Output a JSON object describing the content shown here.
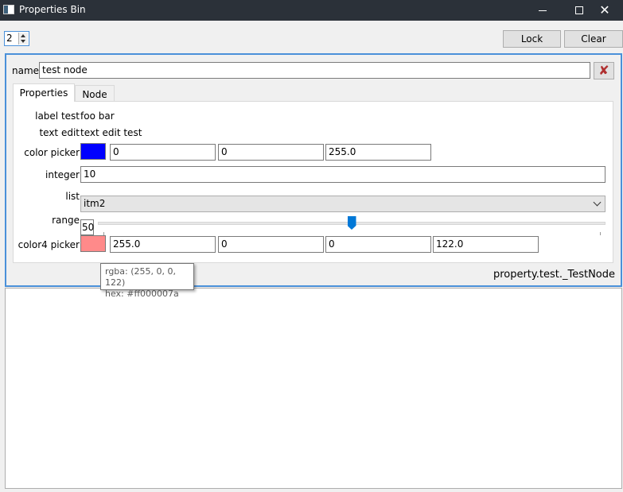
{
  "window": {
    "title": "Properties Bin",
    "controls": {
      "minimize": "minimize-icon",
      "maximize": "maximize-icon",
      "close": "close-icon"
    }
  },
  "toolbar": {
    "spin_value": "2",
    "lock_label": "Lock",
    "clear_label": "Clear"
  },
  "node": {
    "name_label": "name",
    "name_value": "test node",
    "remove_icon": "red-x-icon",
    "tabs": [
      {
        "label": "Properties",
        "active": true
      },
      {
        "label": "Node",
        "active": false
      }
    ],
    "properties": {
      "label_test": {
        "label": "label test",
        "value": "foo bar"
      },
      "text_edit": {
        "label": "text edit",
        "value": "text edit test"
      },
      "color_picker": {
        "label": "color picker",
        "swatch": "#0000ff",
        "values": [
          "0",
          "0",
          "255.0"
        ]
      },
      "integer": {
        "label": "integer",
        "value": "10"
      },
      "list": {
        "label": "list",
        "value": "itm2"
      },
      "range": {
        "label": "range",
        "value": "50",
        "slider_fraction": 0.5
      },
      "color4_picker": {
        "label": "color4 picker",
        "swatch": "#ff8a8a",
        "values": [
          "255.0",
          "0",
          "0",
          "122.0"
        ]
      }
    },
    "node_type": "property.test._TestNode"
  },
  "tooltip": {
    "line1": "rgba: (255, 0, 0, 122)",
    "line2": "hex: #ff000007a"
  },
  "colors": {
    "titlebar": "#2b3139",
    "accent": "#4a90d9",
    "slider_handle": "#0078d7"
  }
}
